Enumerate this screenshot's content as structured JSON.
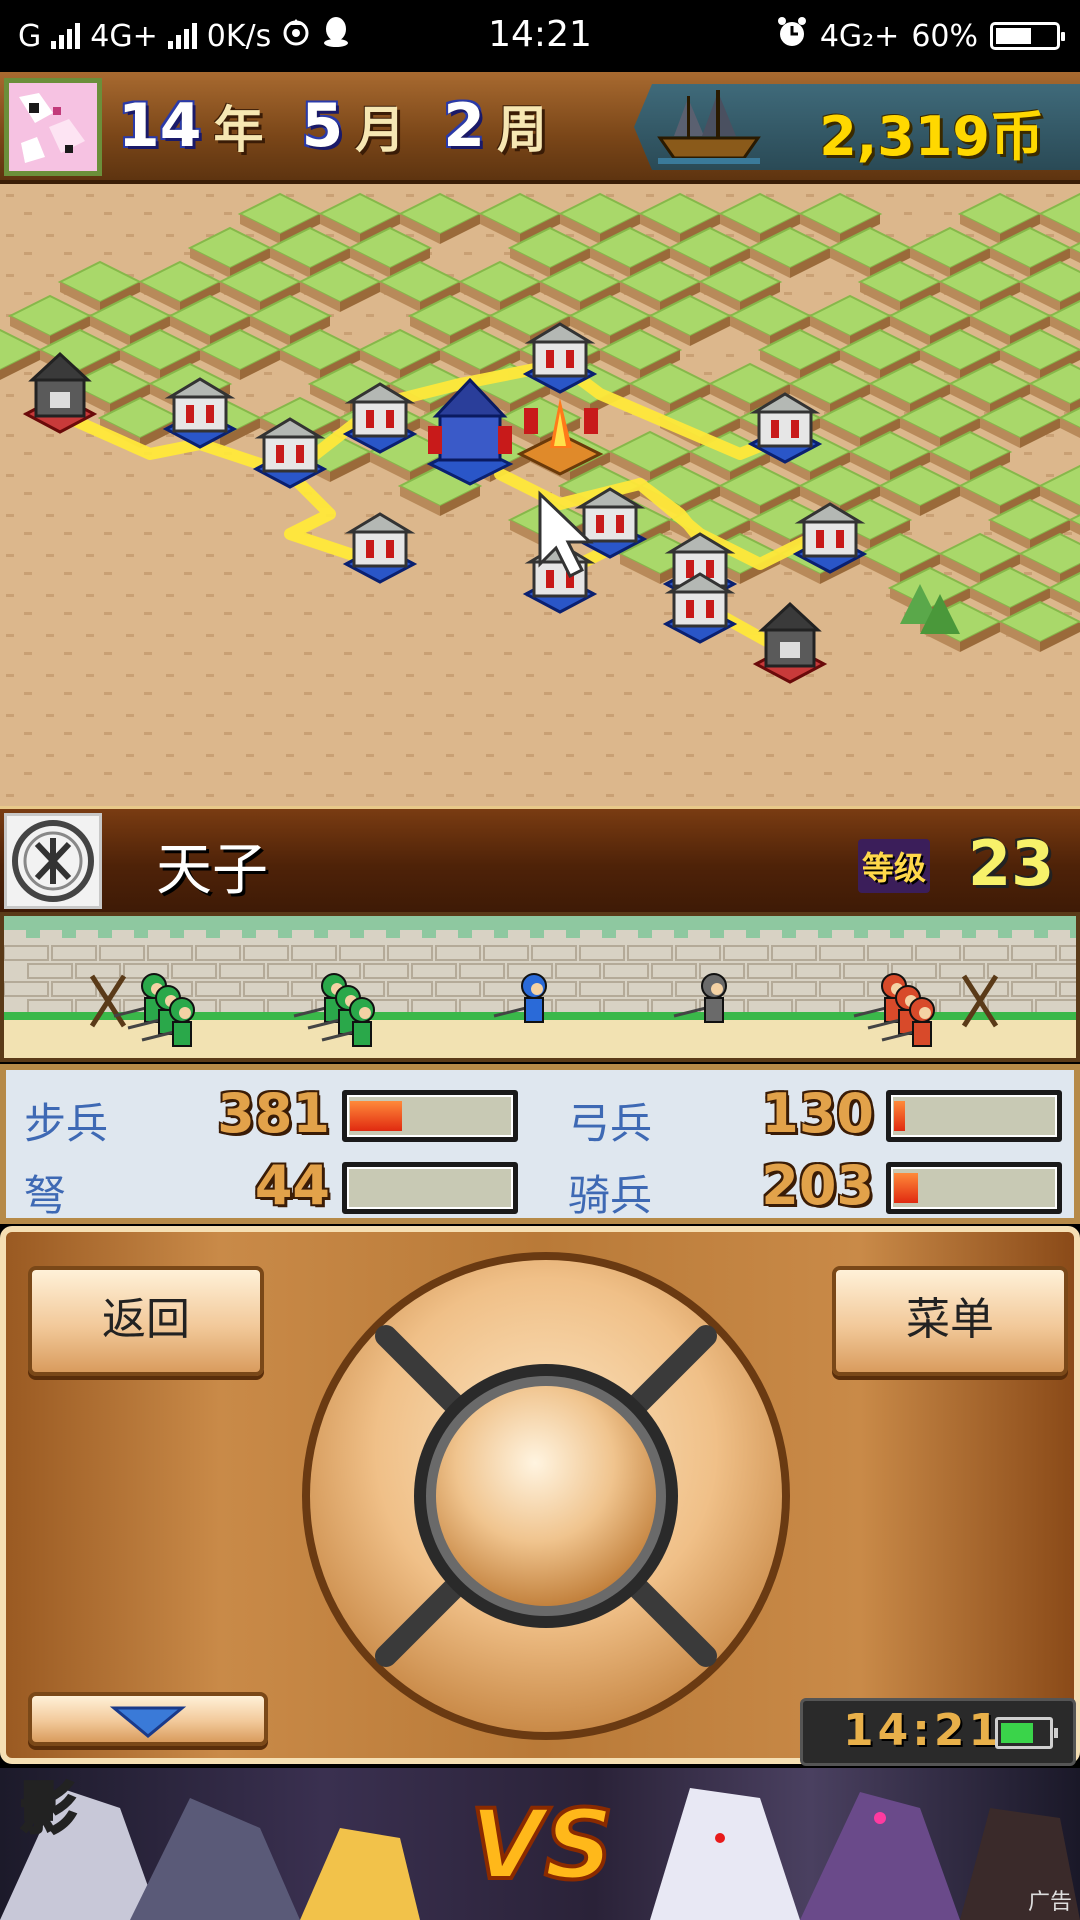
{
  "status_bar": {
    "carrier": "G",
    "network": "4G+",
    "speed": "0K/s",
    "time": "14:21",
    "network2": "4G₂+",
    "battery": "60%",
    "battery_level": 0.6
  },
  "top_bar": {
    "year": "14",
    "year_unit": "年",
    "month": "5",
    "month_unit": "月",
    "week": "2",
    "week_unit": "周",
    "money": "2,319币"
  },
  "unit": {
    "name": "天子",
    "level_label": "等级",
    "level": "23"
  },
  "troops": [
    {
      "name": "步兵",
      "value": "381",
      "fill": 0.35
    },
    {
      "name": "弓兵",
      "value": "130",
      "fill": 0.1
    },
    {
      "name": "弩",
      "value": "44",
      "fill": 0.03
    },
    {
      "name": "骑兵",
      "value": "203",
      "fill": 0.18
    }
  ],
  "controls": {
    "back_label": "返回",
    "menu_label": "菜单",
    "clock": "14:21",
    "device_battery_level": 0.7
  },
  "ad": {
    "label": "广告"
  },
  "colors": {
    "money": "#ffd800",
    "level": "#f7f16a",
    "troop_label": "#3e69b4",
    "bar_fill": "#e02a10"
  }
}
